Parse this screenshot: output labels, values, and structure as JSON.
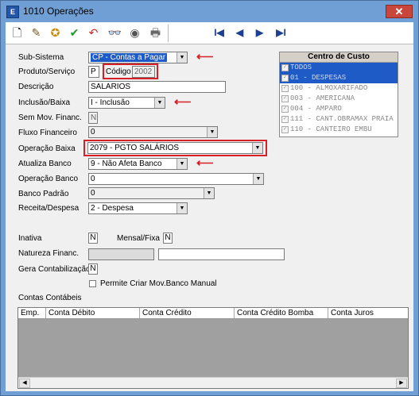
{
  "window": {
    "title": "1010 Operações",
    "app_icon": "app-icon",
    "close_label": "✕"
  },
  "toolbar": {
    "buttons": [
      {
        "icon": "new-document-icon",
        "glyph": "🗋"
      },
      {
        "icon": "edit-pencil-icon",
        "glyph": "✎"
      },
      {
        "icon": "stamp-icon",
        "glyph": "✪"
      },
      {
        "icon": "confirm-check-icon",
        "glyph": "✔"
      },
      {
        "icon": "undo-icon",
        "glyph": "↶"
      },
      {
        "icon": "binoculars-search-icon",
        "glyph": "👓"
      },
      {
        "icon": "delete-disk-icon",
        "glyph": "◉"
      },
      {
        "icon": "printer-icon",
        "glyph": "🖶"
      }
    ],
    "nav": {
      "first": "I◀",
      "prev": "◀",
      "next": "▶",
      "last": "▶I"
    }
  },
  "form": {
    "subsistema": {
      "label": "Sub-Sistema",
      "value": "CP - Contas a Pagar"
    },
    "produto_servico": {
      "label": "Produto/Serviço",
      "value": "P"
    },
    "codigo": {
      "label": "Código",
      "value": "2002"
    },
    "descricao": {
      "label": "Descrição",
      "value": "SALARIOS"
    },
    "inclusao_baixa": {
      "label": "Inclusão/Baixa",
      "value": "I - Inclusão"
    },
    "sem_mov_financ": {
      "label": "Sem Mov. Financ.",
      "value": "N"
    },
    "fluxo_financeiro": {
      "label": "Fluxo Financeiro",
      "value": "0"
    },
    "operacao_baixa": {
      "label": "Operação Baixa",
      "value": "2079 - PGTO SALÁRIOS"
    },
    "atualiza_banco": {
      "label": "Atualiza Banco",
      "value": "9 - Não Afeta Banco"
    },
    "operacao_banco": {
      "label": "Operação Banco",
      "value": "0"
    },
    "banco_padrao": {
      "label": "Banco Padrão",
      "value": "0"
    },
    "receita_despesa": {
      "label": "Receita/Despesa",
      "value": "2 - Despesa"
    },
    "inativa": {
      "label": "Inativa",
      "value": "N"
    },
    "mensal_fixa": {
      "label": "Mensal/Fixa",
      "value": "N"
    },
    "natureza_financ": {
      "label": "Natureza Financ.",
      "value": ""
    },
    "gera_contabilizacao": {
      "label": "Gera Contabilização",
      "value": "N"
    },
    "permite_criar": {
      "label": "Permite Criar Mov.Banco Manual",
      "checked": false
    }
  },
  "centro_custo": {
    "header": "Centro de Custo",
    "items": [
      {
        "label": "TODOS",
        "checked": true,
        "highlighted": true
      },
      {
        "label": "01 - DESPESAS",
        "checked": true,
        "highlighted": true
      },
      {
        "label": "100 - ALMOXARIFADO",
        "checked": true,
        "highlighted": false
      },
      {
        "label": "003 - AMERICANA",
        "checked": true,
        "highlighted": false
      },
      {
        "label": "004 - AMPARO",
        "checked": true,
        "highlighted": false
      },
      {
        "label": "111 - CANT.OBRAMAX PRAIA",
        "checked": true,
        "highlighted": false
      },
      {
        "label": "110 - CANTEIRO EMBU",
        "checked": true,
        "highlighted": false
      }
    ]
  },
  "contas_contabeis": {
    "label": "Contas Contábeis",
    "columns": [
      "Emp.",
      "Conta Débito",
      "Conta Crédito",
      "Conta Crédito Bomba",
      "Conta Juros"
    ]
  },
  "colors": {
    "highlight": "#d81f26",
    "selection": "#1e5bc6",
    "title_bar": "#6f9fd4"
  }
}
